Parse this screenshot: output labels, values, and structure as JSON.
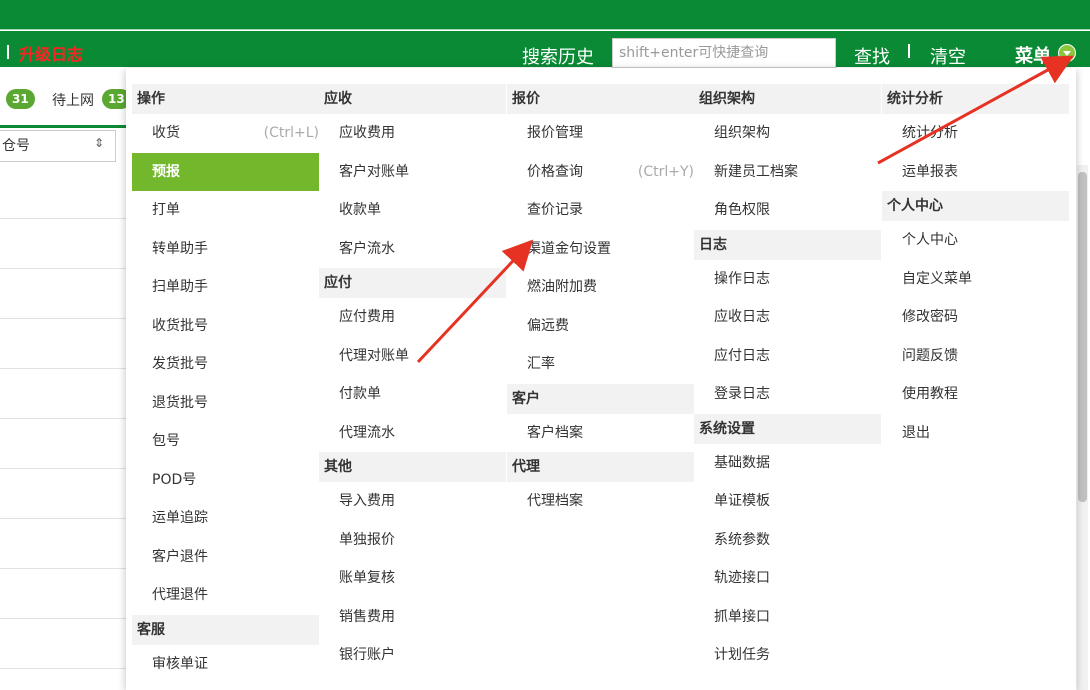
{
  "header": {
    "upgrade_label": "升级日志",
    "history_label": "搜索历史",
    "search_placeholder": "shift+enter可快捷查询",
    "find_label": "查找",
    "clear_label": "清空",
    "menu_label": "菜单"
  },
  "tabs": [
    {
      "label": "",
      "count": "31"
    },
    {
      "label": "待上网",
      "count": "13"
    }
  ],
  "filter": {
    "warehouse_label": "仓号"
  },
  "menu": {
    "col1": {
      "head1": "操作",
      "items1": [
        "收货",
        "预报",
        "打单",
        "转单助手",
        "扫单助手",
        "收货批号",
        "发货批号",
        "退货批号",
        "包号",
        "POD号",
        "运单追踪",
        "客户退件",
        "代理退件"
      ],
      "shortcut_receive": "(Ctrl+L)",
      "head2": "客服",
      "items2": [
        "审核单证"
      ]
    },
    "col2": {
      "head1": "应收",
      "items1": [
        "应收费用",
        "客户对账单",
        "收款单",
        "客户流水"
      ],
      "head2": "应付",
      "items2": [
        "应付费用",
        "代理对账单",
        "付款单",
        "代理流水"
      ],
      "head3": "其他",
      "items3": [
        "导入费用",
        "单独报价",
        "账单复核",
        "销售费用",
        "银行账户"
      ]
    },
    "col3": {
      "head1": "报价",
      "items1": [
        "报价管理",
        "价格查询",
        "查价记录",
        "渠道金句设置",
        "燃油附加费",
        "偏远费",
        "汇率"
      ],
      "shortcut_price": "(Ctrl+Y)",
      "head2": "客户",
      "items2": [
        "客户档案"
      ],
      "head3": "代理",
      "items3": [
        "代理档案"
      ]
    },
    "col4": {
      "head1": "组织架构",
      "items1": [
        "组织架构",
        "新建员工档案",
        "角色权限"
      ],
      "head2": "日志",
      "items2": [
        "操作日志",
        "应收日志",
        "应付日志",
        "登录日志"
      ],
      "head3": "系统设置",
      "items3": [
        "基础数据",
        "单证模板",
        "系统参数",
        "轨迹接口",
        "抓单接口",
        "计划任务"
      ]
    },
    "col5": {
      "head1": "统计分析",
      "items1": [
        "统计分析",
        "运单报表"
      ],
      "head2": "个人中心",
      "items2": [
        "个人中心",
        "自定义菜单",
        "修改密码",
        "问题反馈",
        "使用教程",
        "退出"
      ]
    }
  },
  "colors": {
    "brand_green": "#0a8a35",
    "active_green": "#72b72c",
    "arrow_red": "#e53222"
  }
}
